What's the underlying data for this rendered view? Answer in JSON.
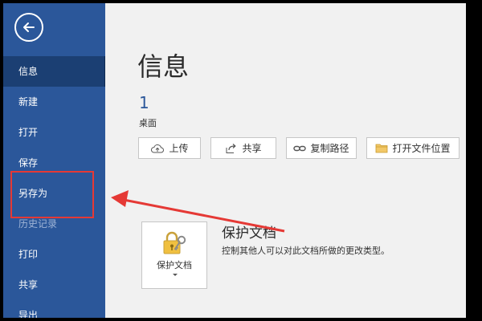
{
  "sidebar": {
    "back_label": "",
    "items": [
      {
        "label": "信息",
        "active": true
      },
      {
        "label": "新建"
      },
      {
        "label": "打开"
      },
      {
        "label": "保存"
      },
      {
        "label": "另存为"
      },
      {
        "label": "历史记录",
        "disabled": true
      },
      {
        "label": "打印"
      },
      {
        "label": "共享"
      },
      {
        "label": "导出"
      }
    ]
  },
  "main": {
    "title": "信息",
    "doc_name": "1",
    "doc_location": "桌面",
    "actions": [
      {
        "label": "上传",
        "icon": "cloud-upload-icon"
      },
      {
        "label": "共享",
        "icon": "share-icon"
      },
      {
        "label": "复制路径",
        "icon": "link-icon"
      },
      {
        "label": "打开文件位置",
        "icon": "folder-icon"
      }
    ],
    "protect": {
      "card_label": "保护文档",
      "title": "保护文档",
      "description": "控制其他人可以对此文档所做的更改类型。"
    }
  },
  "colors": {
    "sidebar": "#2b579a",
    "sidebar_active": "#1b3f73",
    "annotation": "#e53935"
  }
}
